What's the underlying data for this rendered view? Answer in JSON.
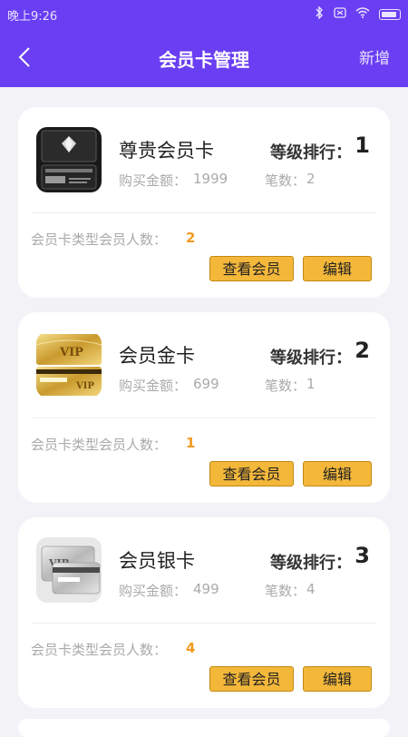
{
  "status_bar": {
    "time": "晚上9:26"
  },
  "header": {
    "title": "会员卡管理",
    "action": "新增"
  },
  "colors": {
    "primary": "#6a3ef2",
    "button": "#f3b73a",
    "highlight": "#f39a21"
  },
  "cards": [
    {
      "name": "尊贵会员卡",
      "rank_label": "等级排行：",
      "rank": "1",
      "price_label": "购买金额：",
      "price": "1999",
      "count_label": "笔数：",
      "count": "2",
      "members_label": "会员卡类型会员人数：",
      "members": "2",
      "view_label": "查看会员",
      "edit_label": "编辑",
      "thumb_icon": "vip-black-card-icon"
    },
    {
      "name": "会员金卡",
      "rank_label": "等级排行：",
      "rank": "2",
      "price_label": "购买金额：",
      "price": "699",
      "count_label": "笔数：",
      "count": "1",
      "members_label": "会员卡类型会员人数：",
      "members": "1",
      "view_label": "查看会员",
      "edit_label": "编辑",
      "thumb_icon": "vip-gold-card-icon"
    },
    {
      "name": "会员银卡",
      "rank_label": "等级排行：",
      "rank": "3",
      "price_label": "购买金额：",
      "price": "499",
      "count_label": "笔数：",
      "count": "4",
      "members_label": "会员卡类型会员人数：",
      "members": "4",
      "view_label": "查看会员",
      "edit_label": "编辑",
      "thumb_icon": "vip-silver-card-icon"
    }
  ]
}
